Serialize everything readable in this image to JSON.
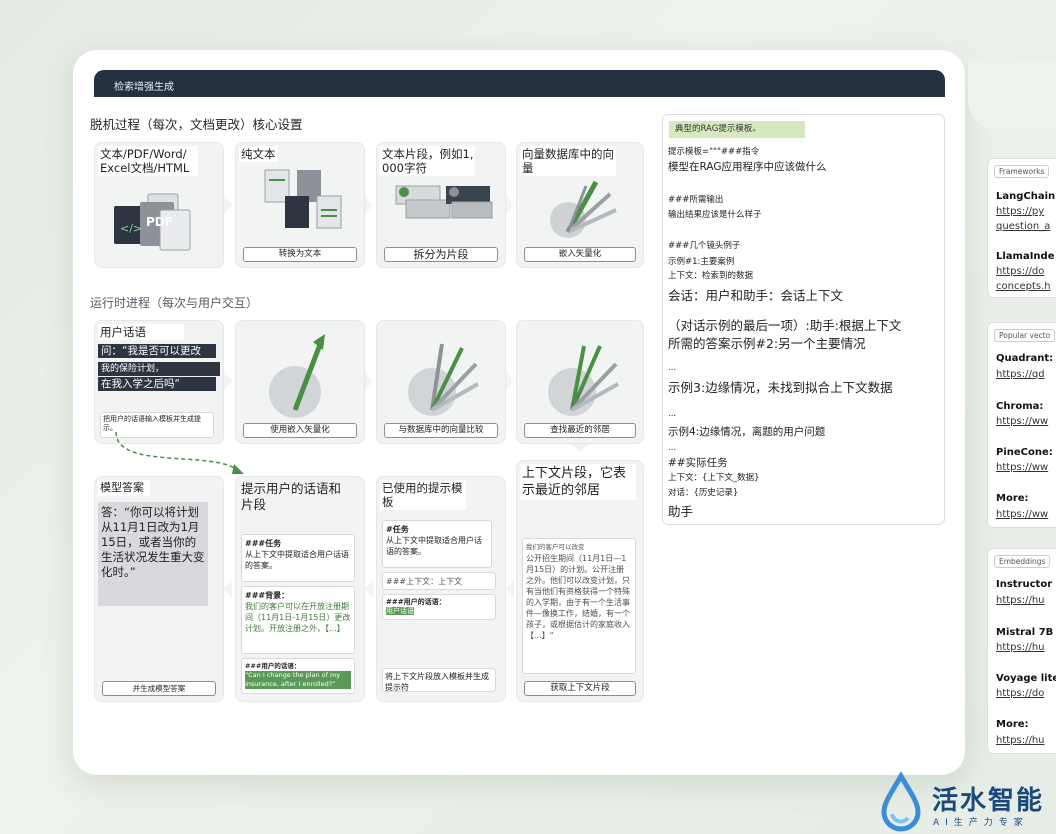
{
  "header": {
    "title": "检索增强生成"
  },
  "offline": {
    "title": "脱机过程（每次，文档更改）核心设置",
    "steps": [
      {
        "label": "文本/PDF/Word/\nExcel文档/HTML",
        "button": ""
      },
      {
        "label": "纯文本",
        "button": "转换为文本"
      },
      {
        "label": "文本片段，例如1,\n000字符",
        "button": "拆分为片段"
      },
      {
        "label": "向量数据库中的向\n量",
        "button": "嵌入矢量化"
      }
    ],
    "pdf_icon_text": "PDF",
    "code_icon_text": "</>"
  },
  "runtime": {
    "title": "运行时进程（每次与用户交互）",
    "user_query": {
      "label": "用户话语",
      "lines": [
        "问：“我是否可以更改",
        "我的保险计划，",
        "在我入学之后吗“"
      ],
      "instruction": "把用户的话语输入模板并生成提示。"
    },
    "buttons": [
      "使用嵌入矢量化",
      "与数据库中的向量比较",
      "查找最近的邻居"
    ]
  },
  "bottom": {
    "answer": {
      "label": "模型答案",
      "text": "答：“你可以将计划从11月1日改为1月15日，或者当你的生活状况发生重大变化时。”",
      "button": "并生成模型答案"
    },
    "prompt_panel": {
      "label": "提示用户的话语和片段",
      "task_title": "###任务",
      "task_text": "从上下文中提取适合用户话语的答案。",
      "bg_title": "###背景：",
      "bg_text": "我们的客户可以在开放注册期间（11月1日-1月15日）更改计划。开放注册之外，【...】",
      "user_title": "###用户的话语：",
      "user_quote": "“Can I change the plan of my insurance, after I enrolled?“"
    },
    "template_panel": {
      "label": "已使用的提示模板",
      "task_title": "#任务",
      "task_text": "从上下文中提取适合用户话语的答案。",
      "ctx": "###上下文：上下文",
      "user_title": "###用户的话语：",
      "user_hl": "用户话语",
      "instruction": "将上下文片段放入模板并生成提示符"
    },
    "context_panel": {
      "label": "上下文片段，它表示最近的邻居",
      "head": "我们的客户可以改变",
      "text": "公开招生期间（11月1日—1月15日）的计划。公开注册之外。他们可以改变计划，只有当他们有资格获得一个特殊的入学期，由于有一个生活事件—像换工作，结婚，有一个孩子，或根据估计的家庭收入【...】“",
      "button": "获取上下文片段"
    }
  },
  "prompt_template": {
    "title": "典型的RAG提示模板。",
    "lines": [
      {
        "text": "提示模板=\"\"\"###指令",
        "size": "s"
      },
      {
        "text": "模型在RAG应用程序中应该做什么",
        "size": "m"
      },
      {
        "text": "###所需输出",
        "size": "s"
      },
      {
        "text": "输出结果应该是什么样子",
        "size": "s"
      },
      {
        "text": "###几个镜头例子",
        "size": "s"
      },
      {
        "text": "示例#1:主要案例",
        "size": "s"
      },
      {
        "text": "上下文：检索到的数据",
        "size": "s"
      },
      {
        "text": "会话：用户和助手：会话上下文",
        "size": "l"
      },
      {
        "text": "（对话示例的最后一项）:助手:根据上下文",
        "size": "l"
      },
      {
        "text": "所需的答案示例#2:另一个主要情况",
        "size": "l"
      },
      {
        "text": "...",
        "size": "s"
      },
      {
        "text": "示例3:边缘情况，未找到拟合上下文数据",
        "size": "l"
      },
      {
        "text": "...",
        "size": "s"
      },
      {
        "text": "示例4:边缘情况，离题的用户问题",
        "size": "m"
      },
      {
        "text": "...",
        "size": "s"
      },
      {
        "text": "##实际任务",
        "size": "m"
      },
      {
        "text": "上下文：{上下文_数据}",
        "size": "s"
      },
      {
        "text": "对话：{历史记录}",
        "size": "s"
      },
      {
        "text": "助手",
        "size": "l"
      }
    ]
  },
  "sidebar": {
    "frameworks": {
      "tag": "Frameworks",
      "items": [
        {
          "name": "LangChain",
          "links": [
            "https://py",
            "question_a"
          ]
        },
        {
          "name": "LlamaInde",
          "links": [
            "https://do",
            "concepts.h"
          ]
        }
      ]
    },
    "vector_dbs": {
      "tag": "Popular vecto",
      "items": [
        {
          "name": "Quadrant:",
          "links": [
            "https://qd"
          ]
        },
        {
          "name": "Chroma:",
          "links": [
            "https://ww"
          ]
        },
        {
          "name": "PineCone:",
          "links": [
            "https://ww"
          ]
        },
        {
          "name": "More:",
          "links": [
            "https://ww"
          ]
        }
      ]
    },
    "embeddings": {
      "tag": "Embeddings",
      "items": [
        {
          "name": "Instructor",
          "links": [
            "https://hu"
          ]
        },
        {
          "name": "Mistral 7B",
          "links": [
            "https://hu"
          ]
        },
        {
          "name": "Voyage lite",
          "links": [
            "https://do"
          ]
        },
        {
          "name": "More:",
          "links": [
            "https://hu"
          ]
        }
      ]
    }
  },
  "brand": {
    "name": "活水智能",
    "tagline": "AI生产力专家"
  },
  "colors": {
    "header": "#253041",
    "accent_green": "#4a8f45",
    "logo_blue": "#1b4a7a"
  }
}
